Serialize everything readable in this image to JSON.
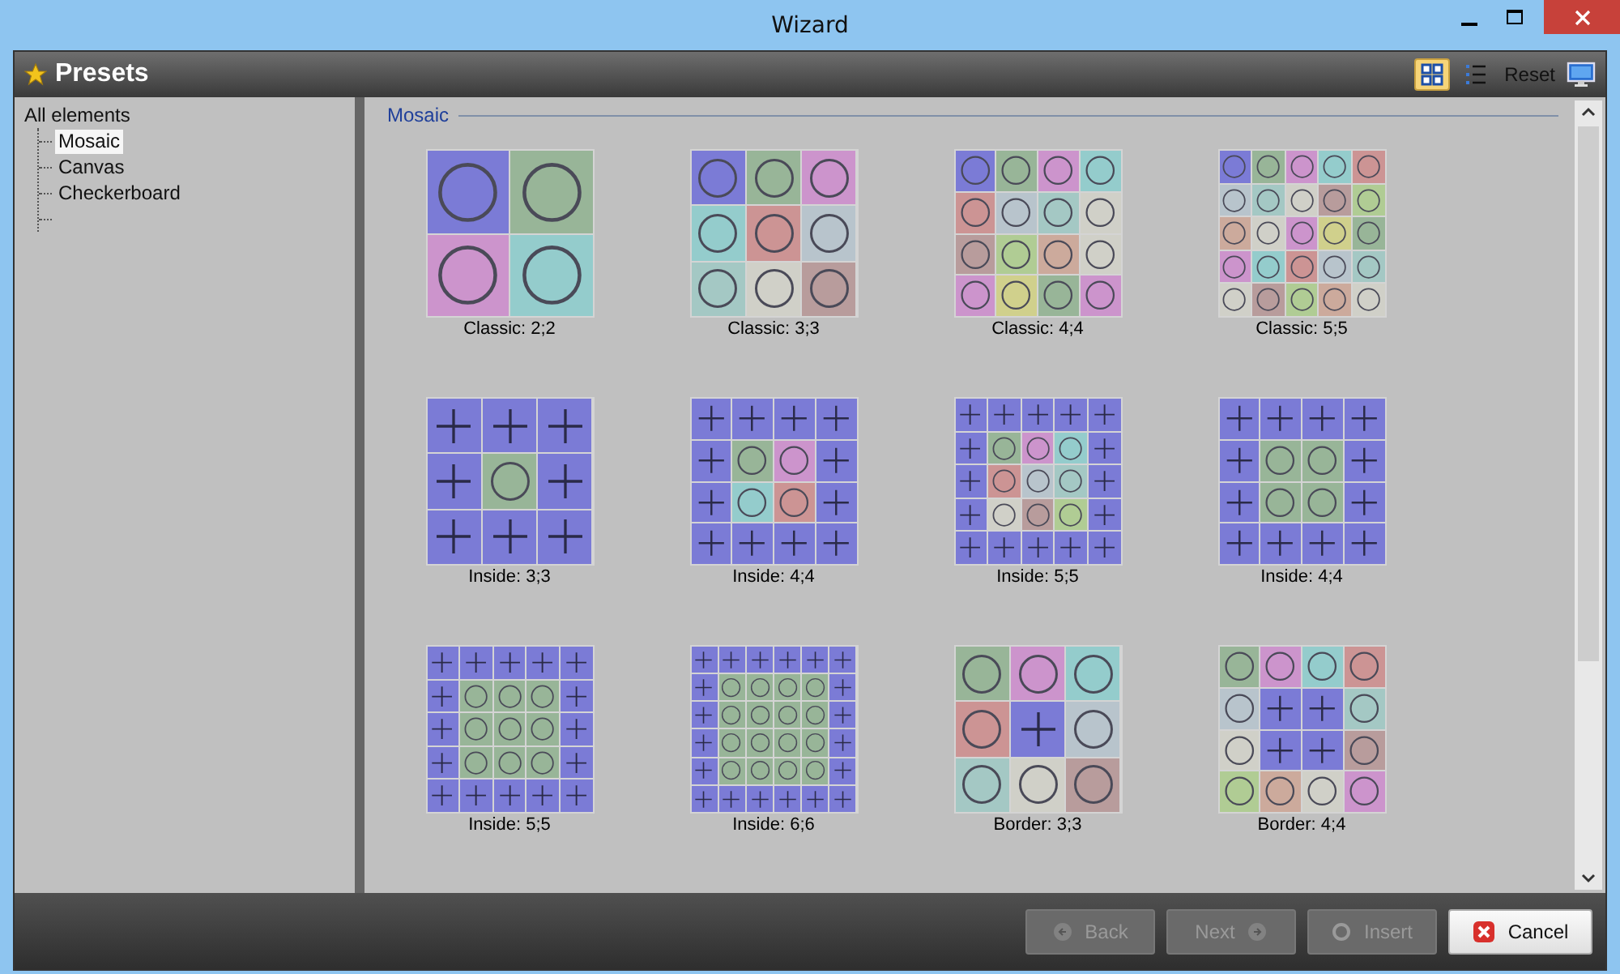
{
  "window": {
    "title": "Wizard"
  },
  "header": {
    "title": "Presets",
    "view_buttons": [
      {
        "selected": true,
        "kind": "grid"
      },
      {
        "selected": false,
        "kind": "list"
      }
    ],
    "reset": "Reset"
  },
  "tree": {
    "label": "All elements",
    "children": [
      {
        "label": "Mosaic",
        "selected": true
      },
      {
        "label": "Canvas",
        "selected": false
      },
      {
        "label": "Checkerboard",
        "selected": false
      }
    ]
  },
  "section": {
    "title": "Mosaic"
  },
  "presets": [
    {
      "label": "Classic: 2;2",
      "rows": [
        [
          {
            "kind": "circle",
            "color": "#7b7bd6"
          },
          {
            "kind": "circle",
            "color": "#98b598"
          }
        ],
        [
          {
            "kind": "circle",
            "color": "#cc94cc"
          },
          {
            "kind": "circle",
            "color": "#94cccc"
          }
        ]
      ]
    },
    {
      "label": "Classic: 3;3",
      "rows": [
        [
          {
            "kind": "circle",
            "color": "#7b7bd6"
          },
          {
            "kind": "circle",
            "color": "#98b598"
          },
          {
            "kind": "circle",
            "color": "#cc94cc"
          }
        ],
        [
          {
            "kind": "circle",
            "color": "#94cccc"
          },
          {
            "kind": "circle",
            "color": "#cc9494"
          },
          {
            "kind": "circle",
            "color": "#b8c4cc"
          }
        ],
        [
          {
            "kind": "circle",
            "color": "#a4c8c4"
          },
          {
            "kind": "circle",
            "color": "#d0d0c8"
          },
          {
            "kind": "circle",
            "color": "#b89c9c"
          }
        ]
      ]
    },
    {
      "label": "Classic: 4;4",
      "rows": [
        [
          {
            "kind": "circle",
            "color": "#7b7bd6"
          },
          {
            "kind": "circle",
            "color": "#98b598"
          },
          {
            "kind": "circle",
            "color": "#cc94cc"
          },
          {
            "kind": "circle",
            "color": "#94cccc"
          }
        ],
        [
          {
            "kind": "circle",
            "color": "#cc9494"
          },
          {
            "kind": "circle",
            "color": "#b8c4cc"
          },
          {
            "kind": "circle",
            "color": "#a4c8c4"
          },
          {
            "kind": "circle",
            "color": "#d0d0c8"
          }
        ],
        [
          {
            "kind": "circle",
            "color": "#b89c9c"
          },
          {
            "kind": "circle",
            "color": "#b0cc94"
          },
          {
            "kind": "circle",
            "color": "#ccaa9c"
          },
          {
            "kind": "circle",
            "color": "#d0d0c8"
          }
        ],
        [
          {
            "kind": "circle",
            "color": "#cc94cc"
          },
          {
            "kind": "circle",
            "color": "#d0d08c"
          },
          {
            "kind": "circle",
            "color": "#98b598"
          },
          {
            "kind": "circle",
            "color": "#cc94cc"
          }
        ]
      ]
    },
    {
      "label": "Classic: 5;5",
      "rows": [
        [
          {
            "kind": "circle",
            "color": "#7b7bd6"
          },
          {
            "kind": "circle",
            "color": "#98b598"
          },
          {
            "kind": "circle",
            "color": "#cc94cc"
          },
          {
            "kind": "circle",
            "color": "#94cccc"
          },
          {
            "kind": "circle",
            "color": "#cc9494"
          }
        ],
        [
          {
            "kind": "circle",
            "color": "#b8c4cc"
          },
          {
            "kind": "circle",
            "color": "#a4c8c4"
          },
          {
            "kind": "circle",
            "color": "#d0d0c8"
          },
          {
            "kind": "circle",
            "color": "#b89c9c"
          },
          {
            "kind": "circle",
            "color": "#b0cc94"
          }
        ],
        [
          {
            "kind": "circle",
            "color": "#ccaa9c"
          },
          {
            "kind": "circle",
            "color": "#d0d0c8"
          },
          {
            "kind": "circle",
            "color": "#cc94cc"
          },
          {
            "kind": "circle",
            "color": "#d0d08c"
          },
          {
            "kind": "circle",
            "color": "#98b598"
          }
        ],
        [
          {
            "kind": "circle",
            "color": "#cc94cc"
          },
          {
            "kind": "circle",
            "color": "#94cccc"
          },
          {
            "kind": "circle",
            "color": "#cc9494"
          },
          {
            "kind": "circle",
            "color": "#b8c4cc"
          },
          {
            "kind": "circle",
            "color": "#a4c8c4"
          }
        ],
        [
          {
            "kind": "circle",
            "color": "#d0d0c8"
          },
          {
            "kind": "circle",
            "color": "#b89c9c"
          },
          {
            "kind": "circle",
            "color": "#b0cc94"
          },
          {
            "kind": "circle",
            "color": "#ccaa9c"
          },
          {
            "kind": "circle",
            "color": "#d0d0c8"
          }
        ]
      ]
    },
    {
      "label": "Inside: 3;3",
      "rows": [
        [
          {
            "kind": "plus",
            "color": "#7b7bd6"
          },
          {
            "kind": "plus",
            "color": "#7b7bd6"
          },
          {
            "kind": "plus",
            "color": "#7b7bd6"
          }
        ],
        [
          {
            "kind": "plus",
            "color": "#7b7bd6"
          },
          {
            "kind": "circle",
            "color": "#98b598"
          },
          {
            "kind": "plus",
            "color": "#7b7bd6"
          }
        ],
        [
          {
            "kind": "plus",
            "color": "#7b7bd6"
          },
          {
            "kind": "plus",
            "color": "#7b7bd6"
          },
          {
            "kind": "plus",
            "color": "#7b7bd6"
          }
        ]
      ]
    },
    {
      "label": "Inside: 4;4",
      "rows": [
        [
          {
            "kind": "plus",
            "color": "#7b7bd6"
          },
          {
            "kind": "plus",
            "color": "#7b7bd6"
          },
          {
            "kind": "plus",
            "color": "#7b7bd6"
          },
          {
            "kind": "plus",
            "color": "#7b7bd6"
          }
        ],
        [
          {
            "kind": "plus",
            "color": "#7b7bd6"
          },
          {
            "kind": "circle",
            "color": "#98b598"
          },
          {
            "kind": "circle",
            "color": "#cc94cc"
          },
          {
            "kind": "plus",
            "color": "#7b7bd6"
          }
        ],
        [
          {
            "kind": "plus",
            "color": "#7b7bd6"
          },
          {
            "kind": "circle",
            "color": "#94cccc"
          },
          {
            "kind": "circle",
            "color": "#cc9494"
          },
          {
            "kind": "plus",
            "color": "#7b7bd6"
          }
        ],
        [
          {
            "kind": "plus",
            "color": "#7b7bd6"
          },
          {
            "kind": "plus",
            "color": "#7b7bd6"
          },
          {
            "kind": "plus",
            "color": "#7b7bd6"
          },
          {
            "kind": "plus",
            "color": "#7b7bd6"
          }
        ]
      ]
    },
    {
      "label": "Inside: 5;5",
      "rows": [
        [
          {
            "kind": "plus",
            "color": "#7b7bd6"
          },
          {
            "kind": "plus",
            "color": "#7b7bd6"
          },
          {
            "kind": "plus",
            "color": "#7b7bd6"
          },
          {
            "kind": "plus",
            "color": "#7b7bd6"
          },
          {
            "kind": "plus",
            "color": "#7b7bd6"
          }
        ],
        [
          {
            "kind": "plus",
            "color": "#7b7bd6"
          },
          {
            "kind": "circle",
            "color": "#98b598"
          },
          {
            "kind": "circle",
            "color": "#cc94cc"
          },
          {
            "kind": "circle",
            "color": "#94cccc"
          },
          {
            "kind": "plus",
            "color": "#7b7bd6"
          }
        ],
        [
          {
            "kind": "plus",
            "color": "#7b7bd6"
          },
          {
            "kind": "circle",
            "color": "#cc9494"
          },
          {
            "kind": "circle",
            "color": "#b8c4cc"
          },
          {
            "kind": "circle",
            "color": "#a4c8c4"
          },
          {
            "kind": "plus",
            "color": "#7b7bd6"
          }
        ],
        [
          {
            "kind": "plus",
            "color": "#7b7bd6"
          },
          {
            "kind": "circle",
            "color": "#d0d0c8"
          },
          {
            "kind": "circle",
            "color": "#b89c9c"
          },
          {
            "kind": "circle",
            "color": "#b0cc94"
          },
          {
            "kind": "plus",
            "color": "#7b7bd6"
          }
        ],
        [
          {
            "kind": "plus",
            "color": "#7b7bd6"
          },
          {
            "kind": "plus",
            "color": "#7b7bd6"
          },
          {
            "kind": "plus",
            "color": "#7b7bd6"
          },
          {
            "kind": "plus",
            "color": "#7b7bd6"
          },
          {
            "kind": "plus",
            "color": "#7b7bd6"
          }
        ]
      ]
    },
    {
      "label": "Inside: 4;4",
      "rows": [
        [
          {
            "kind": "plus",
            "color": "#7b7bd6"
          },
          {
            "kind": "plus",
            "color": "#7b7bd6"
          },
          {
            "kind": "plus",
            "color": "#7b7bd6"
          },
          {
            "kind": "plus",
            "color": "#7b7bd6"
          }
        ],
        [
          {
            "kind": "plus",
            "color": "#7b7bd6"
          },
          {
            "kind": "circle",
            "color": "#98b598"
          },
          {
            "kind": "circle",
            "color": "#98b598"
          },
          {
            "kind": "plus",
            "color": "#7b7bd6"
          }
        ],
        [
          {
            "kind": "plus",
            "color": "#7b7bd6"
          },
          {
            "kind": "circle",
            "color": "#98b598"
          },
          {
            "kind": "circle",
            "color": "#98b598"
          },
          {
            "kind": "plus",
            "color": "#7b7bd6"
          }
        ],
        [
          {
            "kind": "plus",
            "color": "#7b7bd6"
          },
          {
            "kind": "plus",
            "color": "#7b7bd6"
          },
          {
            "kind": "plus",
            "color": "#7b7bd6"
          },
          {
            "kind": "plus",
            "color": "#7b7bd6"
          }
        ]
      ]
    },
    {
      "label": "Inside: 5;5",
      "rows": [
        [
          {
            "kind": "plus",
            "color": "#7b7bd6"
          },
          {
            "kind": "plus",
            "color": "#7b7bd6"
          },
          {
            "kind": "plus",
            "color": "#7b7bd6"
          },
          {
            "kind": "plus",
            "color": "#7b7bd6"
          },
          {
            "kind": "plus",
            "color": "#7b7bd6"
          }
        ],
        [
          {
            "kind": "plus",
            "color": "#7b7bd6"
          },
          {
            "kind": "circle",
            "color": "#98b598"
          },
          {
            "kind": "circle",
            "color": "#98b598"
          },
          {
            "kind": "circle",
            "color": "#98b598"
          },
          {
            "kind": "plus",
            "color": "#7b7bd6"
          }
        ],
        [
          {
            "kind": "plus",
            "color": "#7b7bd6"
          },
          {
            "kind": "circle",
            "color": "#98b598"
          },
          {
            "kind": "circle",
            "color": "#98b598"
          },
          {
            "kind": "circle",
            "color": "#98b598"
          },
          {
            "kind": "plus",
            "color": "#7b7bd6"
          }
        ],
        [
          {
            "kind": "plus",
            "color": "#7b7bd6"
          },
          {
            "kind": "circle",
            "color": "#98b598"
          },
          {
            "kind": "circle",
            "color": "#98b598"
          },
          {
            "kind": "circle",
            "color": "#98b598"
          },
          {
            "kind": "plus",
            "color": "#7b7bd6"
          }
        ],
        [
          {
            "kind": "plus",
            "color": "#7b7bd6"
          },
          {
            "kind": "plus",
            "color": "#7b7bd6"
          },
          {
            "kind": "plus",
            "color": "#7b7bd6"
          },
          {
            "kind": "plus",
            "color": "#7b7bd6"
          },
          {
            "kind": "plus",
            "color": "#7b7bd6"
          }
        ]
      ]
    },
    {
      "label": "Inside: 6;6",
      "rows": [
        [
          {
            "kind": "plus",
            "color": "#7b7bd6"
          },
          {
            "kind": "plus",
            "color": "#7b7bd6"
          },
          {
            "kind": "plus",
            "color": "#7b7bd6"
          },
          {
            "kind": "plus",
            "color": "#7b7bd6"
          },
          {
            "kind": "plus",
            "color": "#7b7bd6"
          },
          {
            "kind": "plus",
            "color": "#7b7bd6"
          }
        ],
        [
          {
            "kind": "plus",
            "color": "#7b7bd6"
          },
          {
            "kind": "circle",
            "color": "#98b598"
          },
          {
            "kind": "circle",
            "color": "#98b598"
          },
          {
            "kind": "circle",
            "color": "#98b598"
          },
          {
            "kind": "circle",
            "color": "#98b598"
          },
          {
            "kind": "plus",
            "color": "#7b7bd6"
          }
        ],
        [
          {
            "kind": "plus",
            "color": "#7b7bd6"
          },
          {
            "kind": "circle",
            "color": "#98b598"
          },
          {
            "kind": "circle",
            "color": "#98b598"
          },
          {
            "kind": "circle",
            "color": "#98b598"
          },
          {
            "kind": "circle",
            "color": "#98b598"
          },
          {
            "kind": "plus",
            "color": "#7b7bd6"
          }
        ],
        [
          {
            "kind": "plus",
            "color": "#7b7bd6"
          },
          {
            "kind": "circle",
            "color": "#98b598"
          },
          {
            "kind": "circle",
            "color": "#98b598"
          },
          {
            "kind": "circle",
            "color": "#98b598"
          },
          {
            "kind": "circle",
            "color": "#98b598"
          },
          {
            "kind": "plus",
            "color": "#7b7bd6"
          }
        ],
        [
          {
            "kind": "plus",
            "color": "#7b7bd6"
          },
          {
            "kind": "circle",
            "color": "#98b598"
          },
          {
            "kind": "circle",
            "color": "#98b598"
          },
          {
            "kind": "circle",
            "color": "#98b598"
          },
          {
            "kind": "circle",
            "color": "#98b598"
          },
          {
            "kind": "plus",
            "color": "#7b7bd6"
          }
        ],
        [
          {
            "kind": "plus",
            "color": "#7b7bd6"
          },
          {
            "kind": "plus",
            "color": "#7b7bd6"
          },
          {
            "kind": "plus",
            "color": "#7b7bd6"
          },
          {
            "kind": "plus",
            "color": "#7b7bd6"
          },
          {
            "kind": "plus",
            "color": "#7b7bd6"
          },
          {
            "kind": "plus",
            "color": "#7b7bd6"
          }
        ]
      ]
    },
    {
      "label": "Border: 3;3",
      "rows": [
        [
          {
            "kind": "circle",
            "color": "#98b598"
          },
          {
            "kind": "circle",
            "color": "#cc94cc"
          },
          {
            "kind": "circle",
            "color": "#94cccc"
          }
        ],
        [
          {
            "kind": "circle",
            "color": "#cc9494"
          },
          {
            "kind": "plus",
            "color": "#7b7bd6"
          },
          {
            "kind": "circle",
            "color": "#b8c4cc"
          }
        ],
        [
          {
            "kind": "circle",
            "color": "#a4c8c4"
          },
          {
            "kind": "circle",
            "color": "#d0d0c8"
          },
          {
            "kind": "circle",
            "color": "#b89c9c"
          }
        ]
      ]
    },
    {
      "label": "Border: 4;4",
      "rows": [
        [
          {
            "kind": "circle",
            "color": "#98b598"
          },
          {
            "kind": "circle",
            "color": "#cc94cc"
          },
          {
            "kind": "circle",
            "color": "#94cccc"
          },
          {
            "kind": "circle",
            "color": "#cc9494"
          }
        ],
        [
          {
            "kind": "circle",
            "color": "#b8c4cc"
          },
          {
            "kind": "plus",
            "color": "#7b7bd6"
          },
          {
            "kind": "plus",
            "color": "#7b7bd6"
          },
          {
            "kind": "circle",
            "color": "#a4c8c4"
          }
        ],
        [
          {
            "kind": "circle",
            "color": "#d0d0c8"
          },
          {
            "kind": "plus",
            "color": "#7b7bd6"
          },
          {
            "kind": "plus",
            "color": "#7b7bd6"
          },
          {
            "kind": "circle",
            "color": "#b89c9c"
          }
        ],
        [
          {
            "kind": "circle",
            "color": "#b0cc94"
          },
          {
            "kind": "circle",
            "color": "#ccaa9c"
          },
          {
            "kind": "circle",
            "color": "#d0d0c8"
          },
          {
            "kind": "circle",
            "color": "#cc94cc"
          }
        ]
      ]
    }
  ],
  "buttons": [
    {
      "label": "Back",
      "kind": "back",
      "disabled": true
    },
    {
      "label": "Next",
      "kind": "next",
      "disabled": true
    },
    {
      "label": "Insert",
      "kind": "insert",
      "disabled": true
    },
    {
      "label": "Cancel",
      "kind": "cancel",
      "disabled": false
    }
  ]
}
